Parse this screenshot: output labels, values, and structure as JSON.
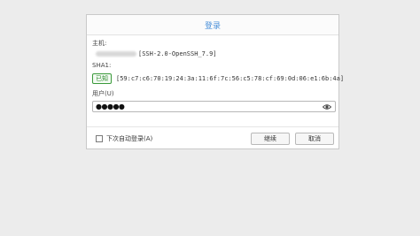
{
  "dialog": {
    "title": "登录",
    "host_label": "主机:",
    "host_version": "[SSH-2.0-OpenSSH_7.9]",
    "sha_label": "SHA1:",
    "known_badge": "已知",
    "fingerprint": "[59:c7:c6:70:19:24:3a:11:6f:7c:56:c5:78:cf:69:0d:06:e1:6b:4a]",
    "user_label": "用户(U)",
    "password_mask": "●●●●●",
    "auto_login_label": "下次自动登录(A)",
    "auto_login_checked": false,
    "continue_label": "继续",
    "cancel_label": "取消"
  },
  "colors": {
    "title": "#4a90d9",
    "known_badge": "#2d8a2d"
  },
  "icons": {
    "password_toggle": "eye-icon"
  }
}
